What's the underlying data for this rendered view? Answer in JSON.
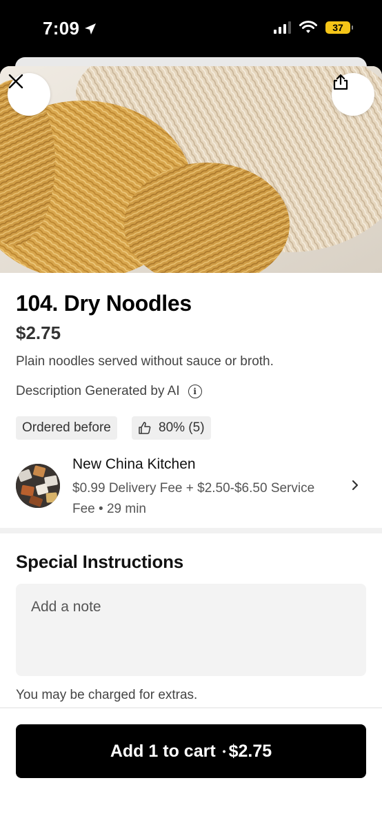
{
  "status_bar": {
    "time": "7:09",
    "battery": "37",
    "icons": [
      "location-arrow-icon",
      "signal-icon",
      "wifi-icon",
      "battery-icon"
    ]
  },
  "header": {
    "close_icon": "close-icon",
    "share_icon": "share-icon"
  },
  "item": {
    "title": "104. Dry Noodles",
    "price": "$2.75",
    "description": "Plain noodles served without sauce or broth.",
    "ai_note": "Description Generated by AI",
    "tags": {
      "ordered_before": "Ordered before",
      "rating": "80% (5)"
    }
  },
  "store": {
    "name": "New China Kitchen",
    "meta": "$0.99 Delivery Fee + $2.50-$6.50 Service Fee • 29 min"
  },
  "instructions": {
    "title": "Special Instructions",
    "placeholder": "Add a note",
    "extras_note": "You may be charged for extras."
  },
  "cart": {
    "label": "Add 1 to cart",
    "separator": "•",
    "price": "$2.75"
  },
  "colors": {
    "accent": "#000000",
    "battery": "#f5c518",
    "chip_bg": "#efefef",
    "input_bg": "#f3f3f3"
  }
}
